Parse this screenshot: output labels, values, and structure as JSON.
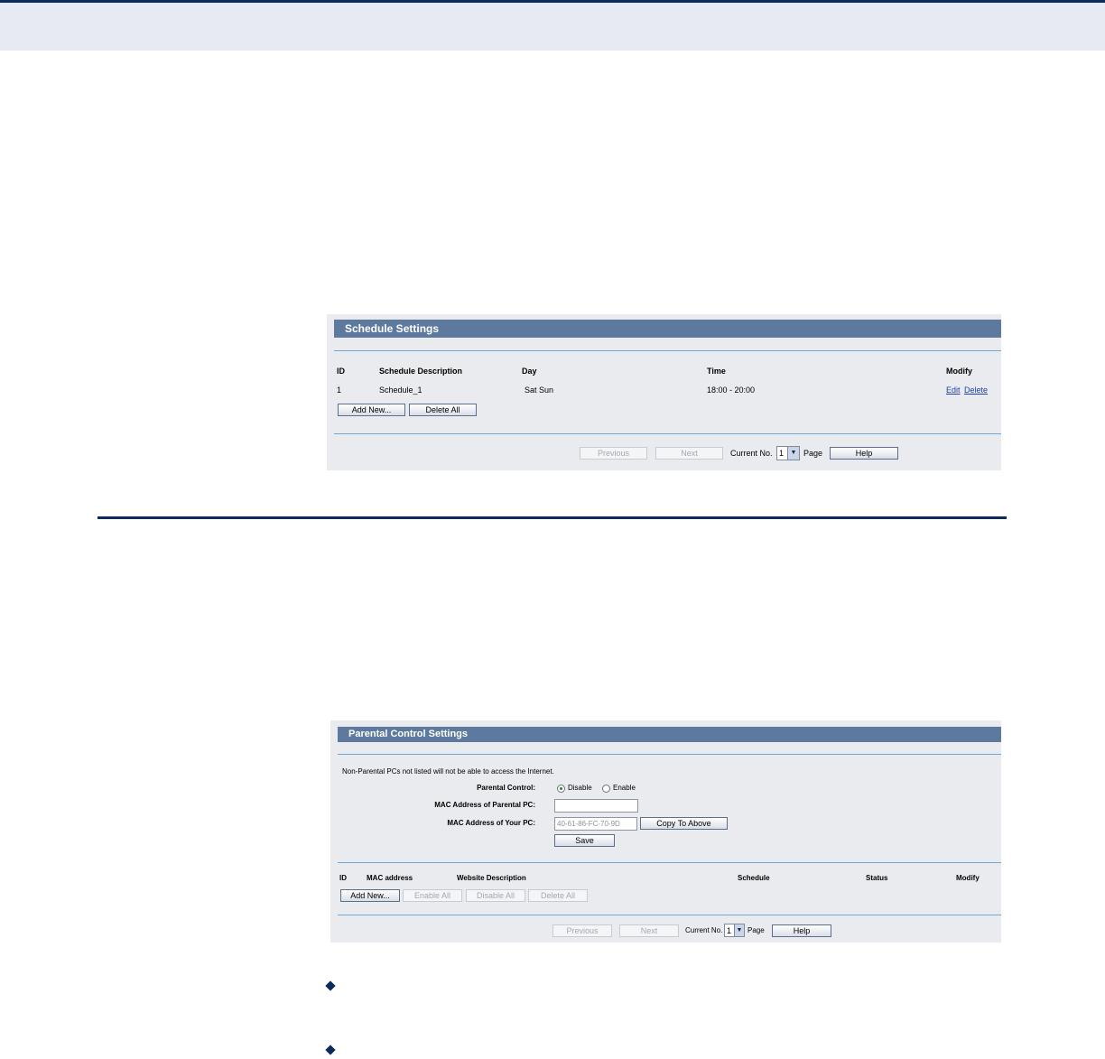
{
  "schedule_panel": {
    "title": "Schedule Settings",
    "columns": [
      "ID",
      "Schedule Description",
      "Day",
      "Time",
      "Modify"
    ],
    "row": {
      "id": "1",
      "description": "Schedule_1",
      "day": "Sat Sun",
      "time": "18:00 - 20:00",
      "edit": "Edit",
      "delete": "Delete"
    },
    "add_new": "Add New...",
    "delete_all": "Delete All",
    "pager": {
      "previous": "Previous",
      "next": "Next",
      "current_no": "Current No.",
      "page_value": "1",
      "page": "Page",
      "help": "Help"
    }
  },
  "parental_panel": {
    "title": "Parental Control Settings",
    "note": "Non-Parental PCs not listed will not be able to access the Internet.",
    "parental_control_label": "Parental Control:",
    "disable_label": "Disable",
    "enable_label": "Enable",
    "selected": "Disable",
    "mac_parental_label": "MAC Address of Parental PC:",
    "mac_parental_value": "",
    "mac_your_label": "MAC Address of Your PC:",
    "mac_your_value": "40-61-86-FC-70-9D",
    "copy_to_above": "Copy To Above",
    "save": "Save",
    "columns": [
      "ID",
      "MAC address",
      "Website Description",
      "Schedule",
      "Status",
      "Modify"
    ],
    "add_new": "Add New...",
    "enable_all": "Enable All",
    "disable_all": "Disable All",
    "delete_all": "Delete All",
    "pager": {
      "previous": "Previous",
      "next": "Next",
      "current_no": "Current No.",
      "page_value": "1",
      "page": "Page",
      "help": "Help"
    }
  },
  "colors": {
    "brand_navy": "#0b2b5f",
    "panel_header": "#5d7a9e",
    "panel_bg": "#e9ebee",
    "link": "#1a3fa8"
  }
}
